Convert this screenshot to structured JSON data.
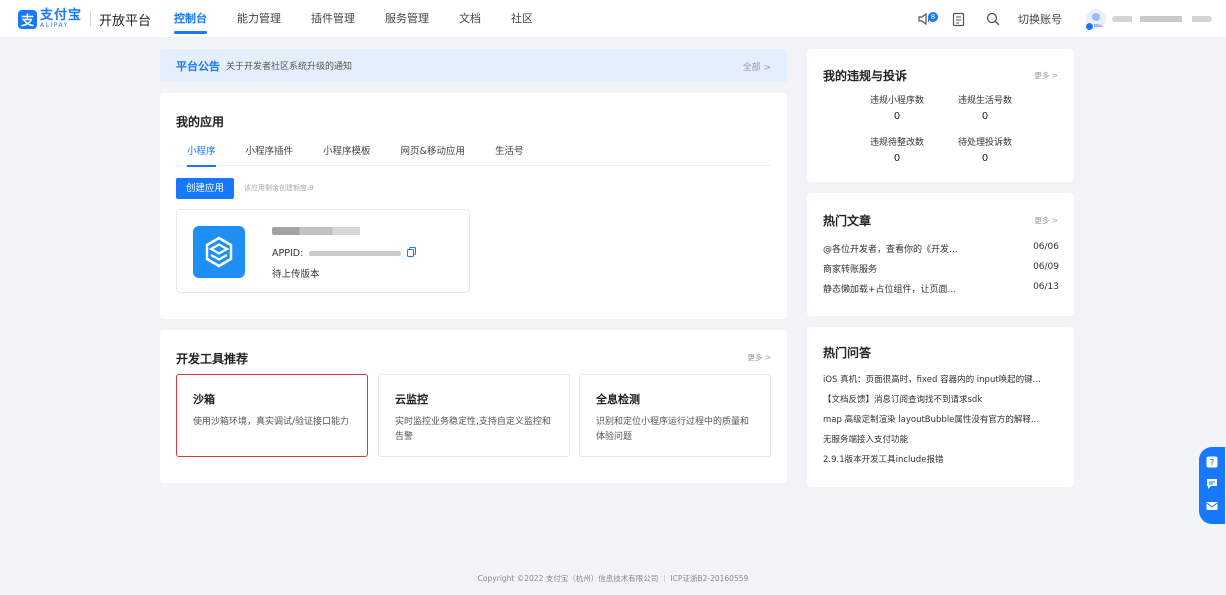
{
  "brand": {
    "mark": "支",
    "name_cn": "支付宝",
    "name_en": "ALIPAY",
    "platform": "开放平台",
    "color": "#1677ff"
  },
  "nav": {
    "items": [
      {
        "label": "控制台",
        "active": true
      },
      {
        "label": "能力管理",
        "active": false
      },
      {
        "label": "插件管理",
        "active": false
      },
      {
        "label": "服务管理",
        "active": false
      },
      {
        "label": "文档",
        "active": false
      },
      {
        "label": "社区",
        "active": false
      }
    ],
    "message_badge": "8",
    "switch_account": "切换账号",
    "icons": [
      "speaker-icon",
      "notice-doc-icon",
      "search-icon"
    ]
  },
  "notice": {
    "title": "平台公告",
    "text": "关于开发者社区系统升级的通知",
    "all": "全部 >"
  },
  "apps": {
    "title": "我的应用",
    "tabs": [
      "小程序",
      "小程序插件",
      "小程序模板",
      "网页&移动应用",
      "生活号"
    ],
    "active_tab": "小程序",
    "create_button": "创建应用",
    "quota_text": "该应用剩余创建额度:9",
    "app": {
      "appid_label": "APPID:",
      "status": "待上传版本"
    }
  },
  "tools": {
    "title": "开发工具推荐",
    "more": "更多 >",
    "items": [
      {
        "title": "沙箱",
        "desc": "使用沙箱环境，真实调试/验证接口能力",
        "selected": true
      },
      {
        "title": "云监控",
        "desc": "实时监控业务稳定性,支持自定义监控和告警",
        "selected": false
      },
      {
        "title": "全息检测",
        "desc": "识别和定位小程序运行过程中的质量和体验问题",
        "selected": false
      }
    ]
  },
  "violations": {
    "title": "我的违规与投诉",
    "more": "更多 >",
    "stats": [
      {
        "label": "违规小程序数",
        "value": "0"
      },
      {
        "label": "违规生活号数",
        "value": "0"
      },
      {
        "label": "违规待整改数",
        "value": "0"
      },
      {
        "label": "待处理投诉数",
        "value": "0"
      }
    ]
  },
  "articles": {
    "title": "热门文章",
    "more": "更多 >",
    "items": [
      {
        "title": "@各位开发者，查看你的《开发...",
        "date": "06/06"
      },
      {
        "title": "商家转账服务",
        "date": "06/09"
      },
      {
        "title": "静态懒加载+占位组件，让页面...",
        "date": "06/13"
      }
    ]
  },
  "qa": {
    "title": "热门问答",
    "items": [
      "iOS 真机：页面很高时，fixed 容器内的 input唤起的键...",
      "【文档反馈】消息订阅查询找不到请求sdk",
      "map 高级定制渲染 layoutBubble属性没有官方的解释...",
      "无服务端接入支付功能",
      "2.9.1版本开发工具include报错"
    ]
  },
  "footer": "Copyright ©2022 支付宝（杭州）信息技术有限公司 ｜ ICP证浙B2-20160559"
}
